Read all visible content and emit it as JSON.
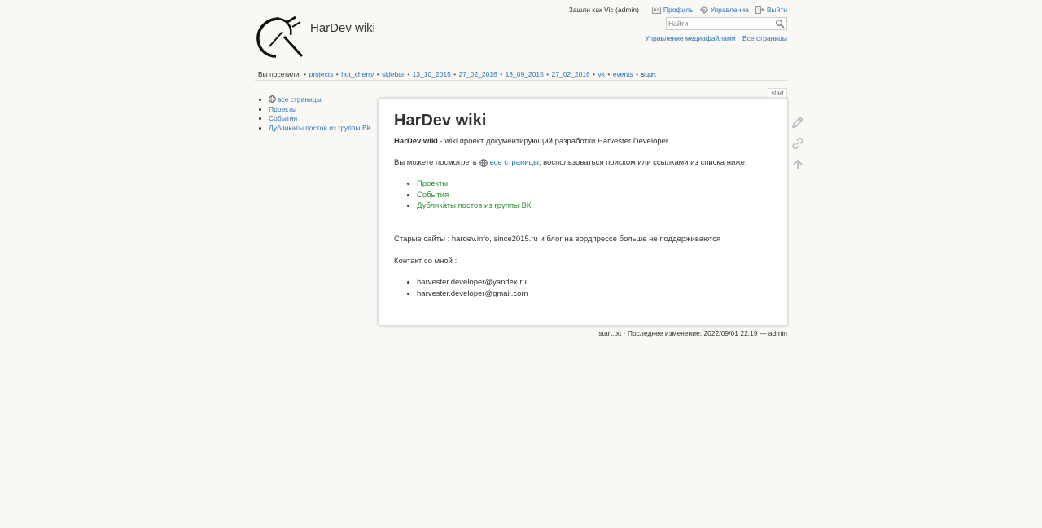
{
  "header": {
    "title": "HarDev wiki",
    "logged_in_text": "Зашли как Vic (admin)",
    "user_tools": {
      "profile": "Профиль",
      "admin": "Управление",
      "logout": "Выйти"
    },
    "search": {
      "placeholder": "Найти"
    },
    "site_tools": {
      "media": "Управление медиафайлами",
      "index": "Все страницы"
    }
  },
  "breadcrumbs": {
    "label": "Вы посетили:",
    "items": [
      "projects",
      "hot_cherry",
      "sidebar",
      "13_10_2015",
      "27_02_2016",
      "13_09_2015",
      "27_02_2016",
      "vk",
      "events"
    ],
    "current": "start"
  },
  "sidebar": {
    "items": [
      "все страницы",
      "Проекты",
      "События",
      "Дубликаты постов из группы ВК"
    ]
  },
  "page": {
    "id": "start",
    "heading": "HarDev wiki",
    "intro_bold": "HarDev wiki",
    "intro_rest": " - wiki проект документирующий разработки Harvester Developer.",
    "p2_before": "Вы можете посмотреть",
    "p2_link": "все страницы",
    "p2_after": ", воспользоваться поиском или ссылками из списка ниже.",
    "links": [
      "Проекты",
      "События",
      "Дубликаты постов из группы ВК"
    ],
    "old_sites": "Старые сайты : hardev.info, since2015.ru и блог на вордпрессе больше не поддерживаются",
    "contact_label": "Контакт со мной :",
    "contacts": [
      "harvester.developer@yandex.ru",
      "harvester.developer@gmail.com"
    ]
  },
  "docinfo": {
    "file": "start.txt",
    "rest": " · Последнее изменение: 2022/09/01 22:19 — admin"
  },
  "colors": {
    "background": "#f9f8f5",
    "link": "#2b73b7",
    "existing_link": "#2b8a2b",
    "text": "#333333"
  }
}
